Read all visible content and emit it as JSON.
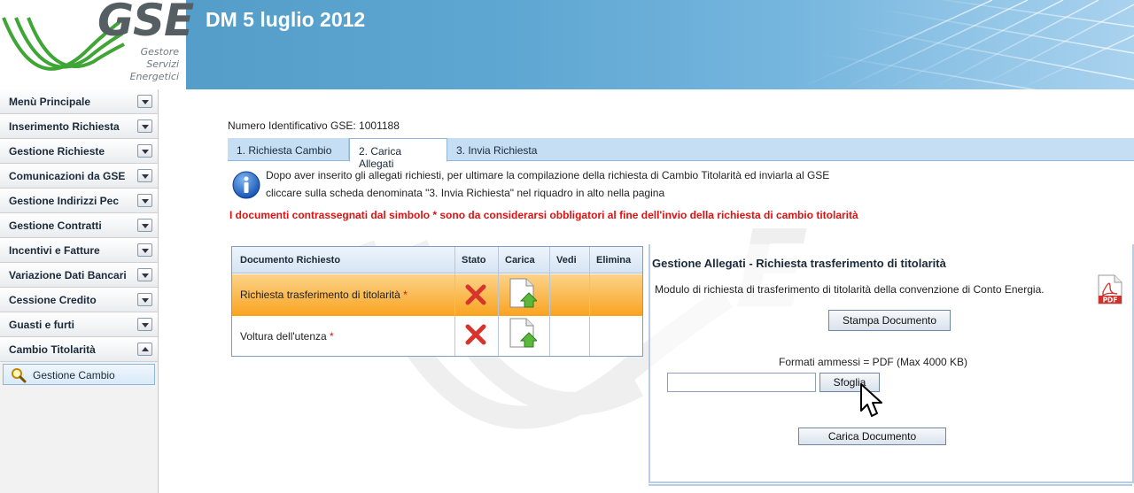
{
  "header": {
    "logo_text": "GSE",
    "logo_sub": [
      "Gestore",
      "Servizi",
      "Energetici"
    ],
    "title": "DM 5 luglio 2012"
  },
  "sidebar": {
    "items": [
      {
        "label": "Menù Principale",
        "expanded": false
      },
      {
        "label": "Inserimento Richiesta",
        "expanded": false
      },
      {
        "label": "Gestione Richieste",
        "expanded": false
      },
      {
        "label": "Comunicazioni da GSE",
        "expanded": false
      },
      {
        "label": "Gestione Indirizzi Pec",
        "expanded": false
      },
      {
        "label": "Gestione Contratti",
        "expanded": false
      },
      {
        "label": "Incentivi e Fatture",
        "expanded": false
      },
      {
        "label": "Variazione Dati Bancari",
        "expanded": false
      },
      {
        "label": "Cessione Credito",
        "expanded": false
      },
      {
        "label": "Guasti e furti",
        "expanded": false
      },
      {
        "label": "Cambio Titolarità",
        "expanded": true
      }
    ],
    "subitem": {
      "label": "Gestione Cambio",
      "icon": "magnifier-icon"
    }
  },
  "main": {
    "gse_id": "Numero Identificativo GSE: 1001188",
    "tabs": [
      {
        "label": "1. Richiesta Cambio",
        "active": false
      },
      {
        "label": "2. Carica Allegati",
        "active": true
      },
      {
        "label": "3. Invia Richiesta",
        "active": false
      }
    ],
    "info_line1": "Dopo aver inserito gli allegati richiesti, per ultimare la compilazione della richiesta di Cambio Titolarità ed inviarla al GSE",
    "info_line2": "cliccare sulla scheda denominata \"3. Invia Richiesta\" nel riquadro in alto nella pagina",
    "warning": "I documenti contrassegnati dal simbolo * sono da considerarsi obbligatori al fine dell'invio della richiesta di cambio titolarità"
  },
  "documents": {
    "headers": [
      "Documento Richiesto",
      "Stato",
      "Carica",
      "Vedi",
      "Elimina"
    ],
    "rows": [
      {
        "name": "Richiesta trasferimento di titolarità",
        "required_mark": "*",
        "status_icon": "red-x-icon",
        "upload_icon": "upload-document-icon",
        "selected": true
      },
      {
        "name": "Voltura dell'utenza",
        "required_mark": "*",
        "status_icon": "red-x-icon",
        "upload_icon": "upload-document-icon",
        "selected": false
      }
    ]
  },
  "panel": {
    "title": "Gestione Allegati - Richiesta trasferimento di titolarità",
    "description": "Modulo di richiesta di trasferimento di titolarità della convenzione di Conto Energia.",
    "pdf_label": "PDF",
    "print_button": "Stampa Documento",
    "formats": "Formati ammessi = PDF (Max 4000 KB)",
    "file_value": "",
    "browse_button": "Sfoglia",
    "upload_button": "Carica Documento"
  },
  "colors": {
    "header_blue": "#5ea7d2",
    "warning_red": "#e01010",
    "selected_row": "#f9a41f",
    "logo_green": "#3fa535"
  }
}
